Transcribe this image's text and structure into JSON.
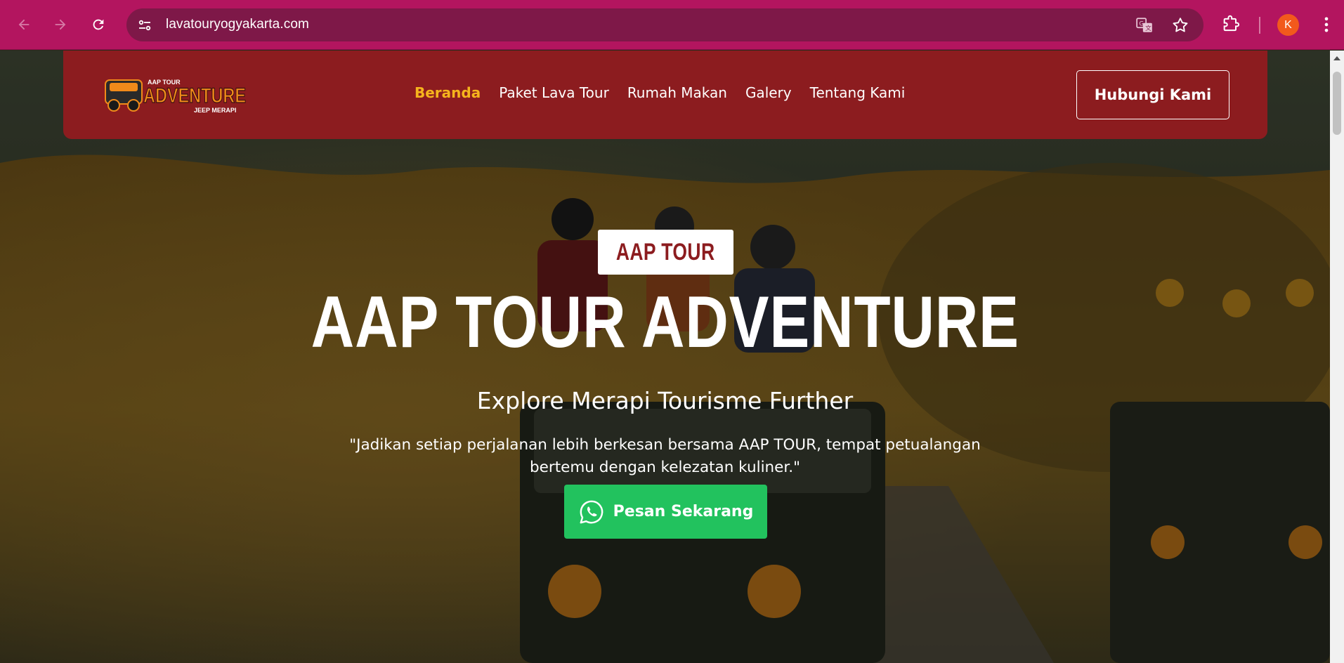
{
  "browser": {
    "url": "lavatouryogyakarta.com",
    "profile_initial": "K",
    "accent_color": "#b3155f"
  },
  "site": {
    "logo_alt": "AAP TOUR ADVENTURE JEEP MERAPI",
    "logo": {
      "top": "AAP TOUR",
      "main": "ADVENTURE",
      "bottom": "JEEP MERAPI"
    },
    "nav": [
      {
        "label": "Beranda",
        "active": true
      },
      {
        "label": "Paket Lava Tour",
        "active": false
      },
      {
        "label": "Rumah Makan",
        "active": false
      },
      {
        "label": "Galery",
        "active": false
      },
      {
        "label": "Tentang Kami",
        "active": false
      }
    ],
    "contact_label": "Hubungi Kami",
    "header_color": "#8c1c1f",
    "active_color": "#f5b41d"
  },
  "hero": {
    "badge": "AAP TOUR",
    "title": "AAP TOUR ADVENTURE",
    "subtitle": "Explore Merapi Tourisme Further",
    "quote": "\"Jadikan setiap perjalanan lebih berkesan bersama AAP TOUR, tempat petualangan bertemu dengan kelezatan kuliner.\"",
    "cta_label": "Pesan Sekarang",
    "cta_color": "#22c25e"
  }
}
